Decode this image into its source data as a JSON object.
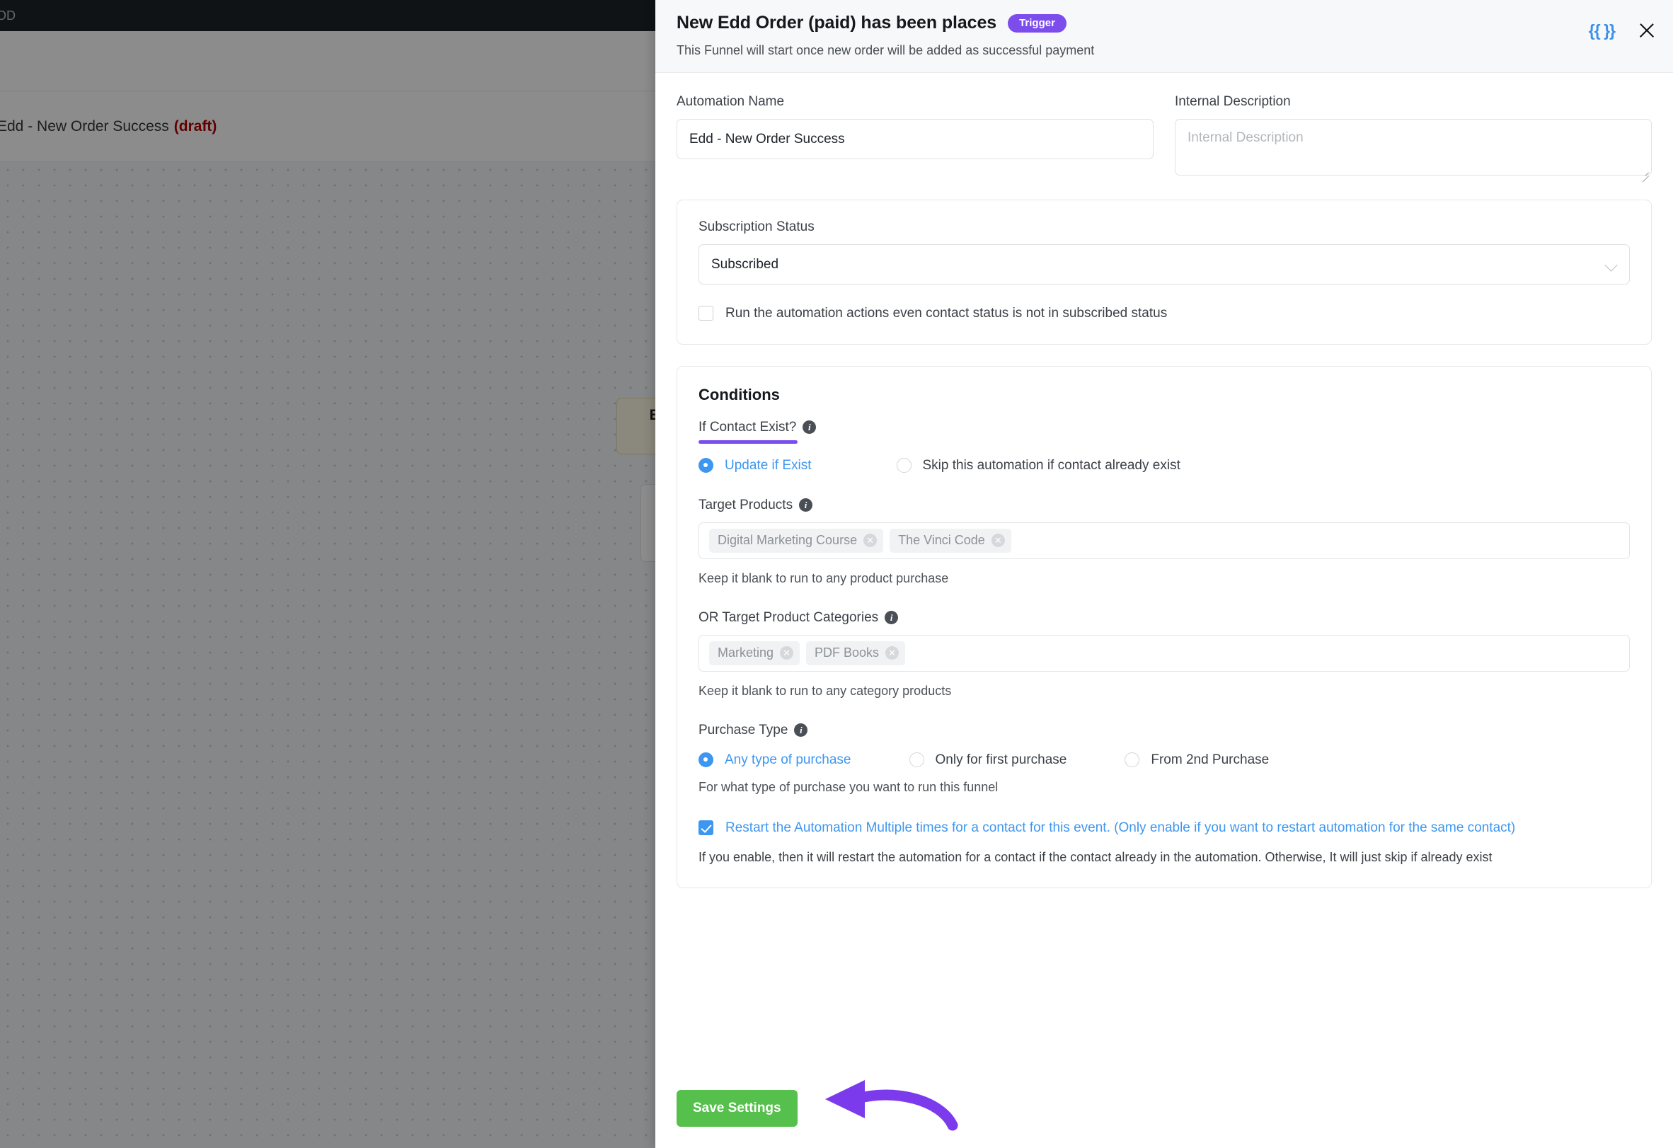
{
  "background": {
    "adminbar_text": "DD",
    "page_title": "Edd - New Order Success",
    "page_status": "(draft)",
    "node_title": "Ed",
    "node_sub": "E"
  },
  "header": {
    "title": "New Edd Order (paid) has been places",
    "badge": "Trigger",
    "subtitle": "This Funnel will start once new order will be added as successful payment",
    "shortcode_icon": "{{ }}",
    "shortcode_icon_name": "shortcode-icon",
    "close_icon_name": "close-icon",
    "badge_color": "#7c4dec"
  },
  "fields": {
    "automation_name_label": "Automation Name",
    "automation_name_value": "Edd - New Order Success",
    "internal_description_label": "Internal Description",
    "internal_description_value": "",
    "internal_description_placeholder": "Internal Description"
  },
  "subscription": {
    "label": "Subscription Status",
    "selected": "Subscribed",
    "options": [
      "Subscribed"
    ],
    "checkbox_label": "Run the automation actions even contact status is not in subscribed status",
    "checkbox_checked": false
  },
  "conditions": {
    "title": "Conditions",
    "contact_exist": {
      "label": "If Contact Exist?",
      "underline_color": "#7c4dec",
      "options": [
        {
          "label": "Update if Exist",
          "selected": true
        },
        {
          "label": "Skip this automation if contact already exist",
          "selected": false
        }
      ]
    },
    "target_products": {
      "label": "Target Products",
      "tags": [
        "Digital Marketing Course",
        "The Vinci Code"
      ],
      "hint": "Keep it blank to run to any product purchase"
    },
    "target_categories": {
      "label": "OR Target Product Categories",
      "tags": [
        "Marketing",
        "PDF Books"
      ],
      "hint": "Keep it blank to run to any category products"
    },
    "purchase_type": {
      "label": "Purchase Type",
      "options": [
        {
          "label": "Any type of purchase",
          "selected": true
        },
        {
          "label": "Only for first purchase",
          "selected": false
        },
        {
          "label": "From 2nd Purchase",
          "selected": false
        }
      ],
      "hint": "For what type of purchase you want to run this funnel"
    },
    "restart": {
      "label": "Restart the Automation Multiple times for a contact for this event. (Only enable if you want to restart automation for the same contact)",
      "checked": true,
      "help": "If you enable, then it will restart the automation for a contact if the contact already in the automation. Otherwise, It will just skip if already exist"
    }
  },
  "footer": {
    "save_label": "Save Settings",
    "save_color": "#55c04b",
    "annotation_arrow_color": "#7c3aed"
  }
}
